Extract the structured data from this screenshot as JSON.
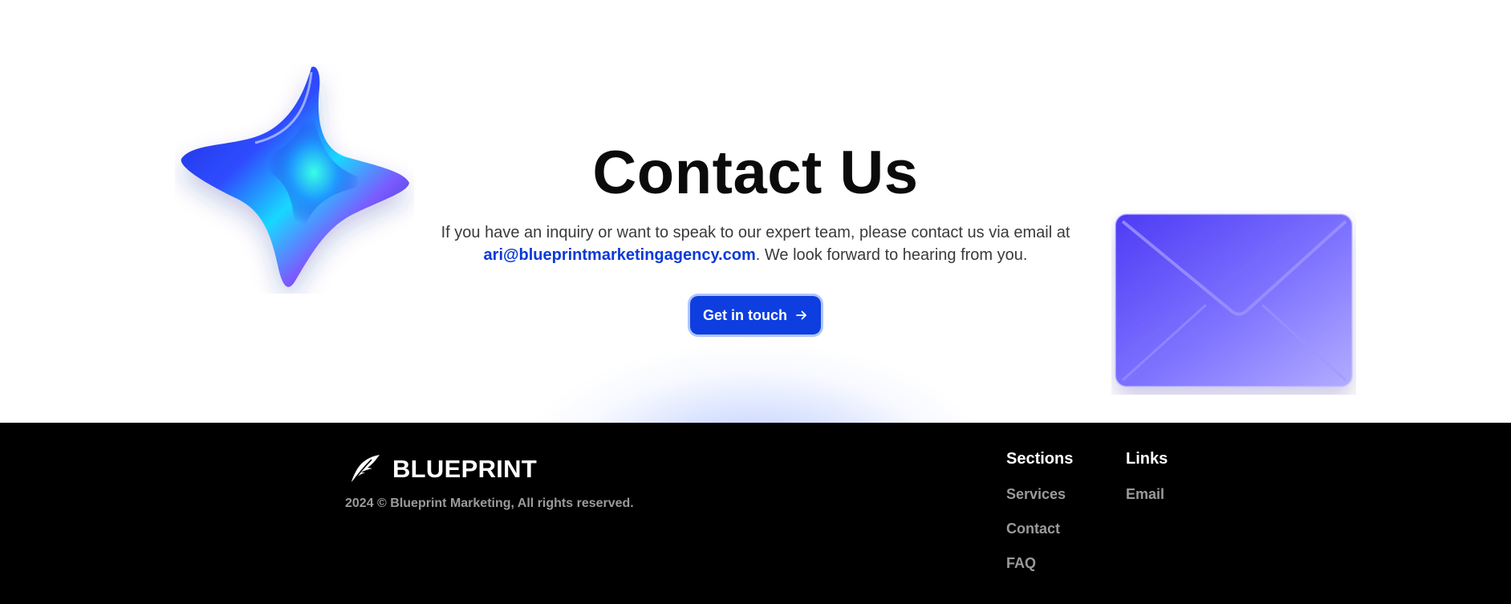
{
  "contact": {
    "title": "Contact Us",
    "description_before": "If you have an inquiry or want to speak to our expert team, please contact us via email at",
    "email": "ari@blueprintmarketingagency.com",
    "description_after": ". We look forward to hearing from you.",
    "cta_label": "Get in touch"
  },
  "footer": {
    "brand": "BLUEPRINT",
    "copyright": "2024 © Blueprint Marketing, All rights reserved.",
    "sections": {
      "heading": "Sections",
      "items": [
        "Services",
        "Contact",
        "FAQ"
      ]
    },
    "links": {
      "heading": "Links",
      "items": [
        "Email"
      ]
    }
  },
  "colors": {
    "accent": "#0e3ee0",
    "link": "#0a3ad8",
    "footer_bg": "#000000",
    "footer_muted": "#9a9a9c"
  },
  "icons": {
    "cta": "arrow-right-icon",
    "brand": "feather-icon",
    "decor_left": "sparkle-star-icon",
    "decor_right": "envelope-icon"
  }
}
